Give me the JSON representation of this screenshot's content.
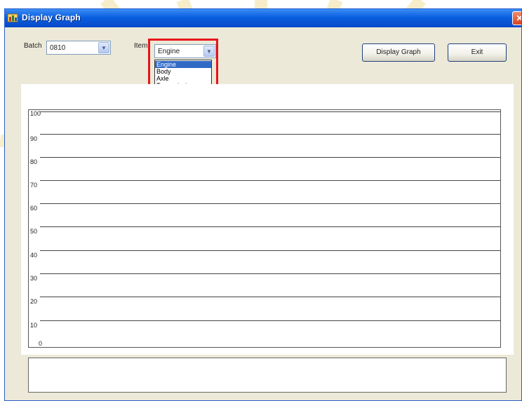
{
  "window": {
    "title": "Display Graph",
    "close_glyph": "✕"
  },
  "form": {
    "batch_label": "Batch",
    "batch_value": "0810",
    "item_label": "Item",
    "item_value": "Engine",
    "item_options": [
      "Engine",
      "Body",
      "Axle",
      "Transmission"
    ],
    "item_selected_index": 0
  },
  "buttons": {
    "display_graph": "Display Graph",
    "exit": "Exit"
  },
  "graph": {
    "y_ticks": [
      "100",
      "90",
      "80",
      "70",
      "60",
      "50",
      "40",
      "30",
      "20",
      "10",
      "0"
    ]
  },
  "colors": {
    "title_bar": "#0a5fe0",
    "highlight": "#e8141c",
    "selection": "#316ac5"
  },
  "icons": {
    "app": "app-window-icon",
    "close": "close-icon",
    "dropdown": "chevron-down-icon"
  }
}
